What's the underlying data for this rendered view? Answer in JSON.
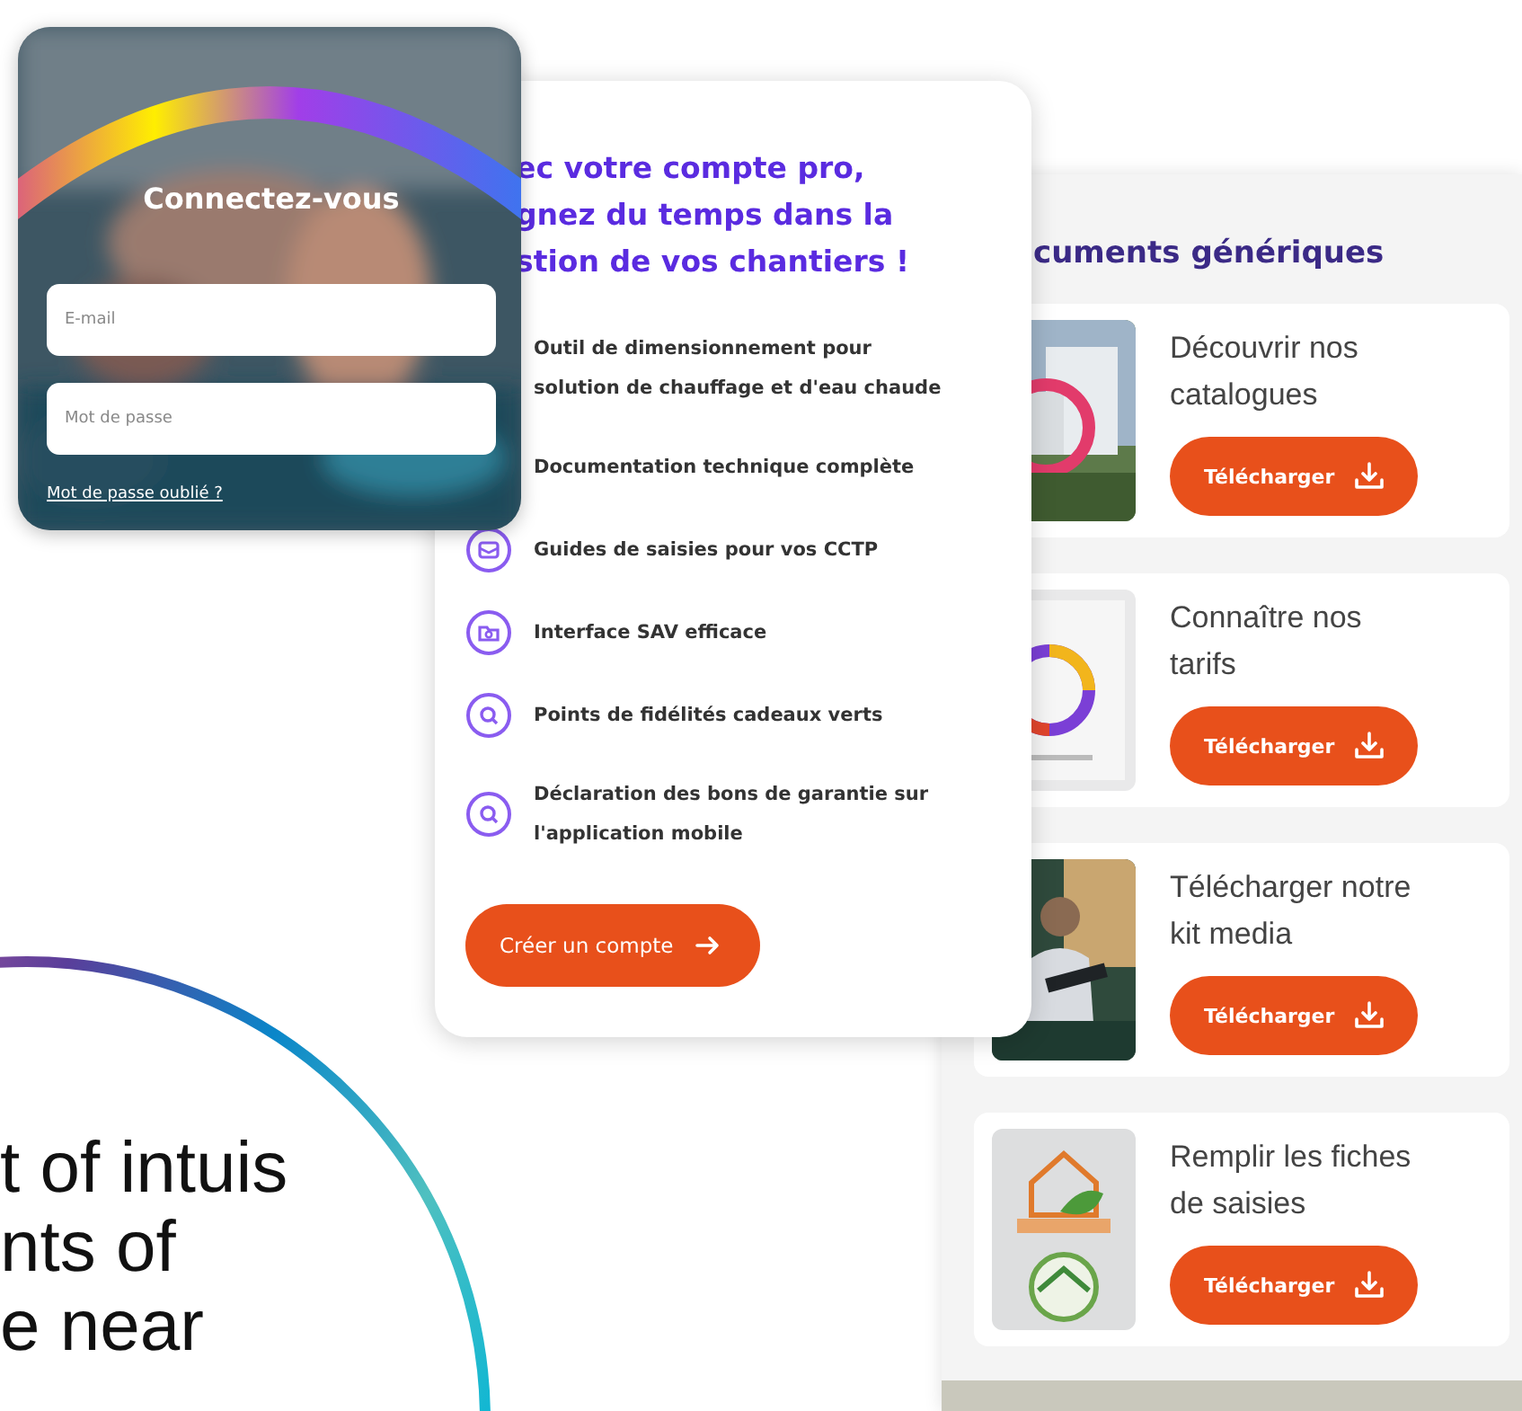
{
  "login_card": {
    "title": "Connectez-vous",
    "fields": [
      {
        "placeholder": "E-mail"
      },
      {
        "placeholder": "Mot de passe"
      }
    ],
    "link": "Mot de passe oublié ?"
  },
  "pro_card": {
    "heading": "ec votre compte pro,\ngnez du temps dans la\nstion de vos chantiers !",
    "features": [
      {
        "kind": "covered",
        "text": "Outil de dimensionnement pour\nsolution de chauffage et d'eau chaude"
      },
      {
        "kind": "covered",
        "text": "Documentation technique complète"
      },
      {
        "kind": "mail",
        "text": "Guides de saisies pour vos CCTP"
      },
      {
        "kind": "folder",
        "text": "Interface SAV efficace"
      },
      {
        "kind": "search",
        "text": "Points de fidélités cadeaux verts"
      },
      {
        "kind": "search",
        "text": "Déclaration des bons de garantie sur\nl'application mobile"
      }
    ],
    "button": "Créer un compte"
  },
  "documents": {
    "title": "cuments génériques",
    "items": [
      {
        "title": "Découvrir nos\ncatalogues",
        "button": "Télécharger"
      },
      {
        "title": "Connaître nos\ntarifs",
        "button": "Télécharger"
      },
      {
        "title": "Télécharger notre\nkit media",
        "button": "Télécharger"
      },
      {
        "title": "Remplir les fiches\nde saisies",
        "button": "Télécharger"
      }
    ]
  },
  "banner": {
    "text": "t of intuis\nnts of\ne near"
  }
}
